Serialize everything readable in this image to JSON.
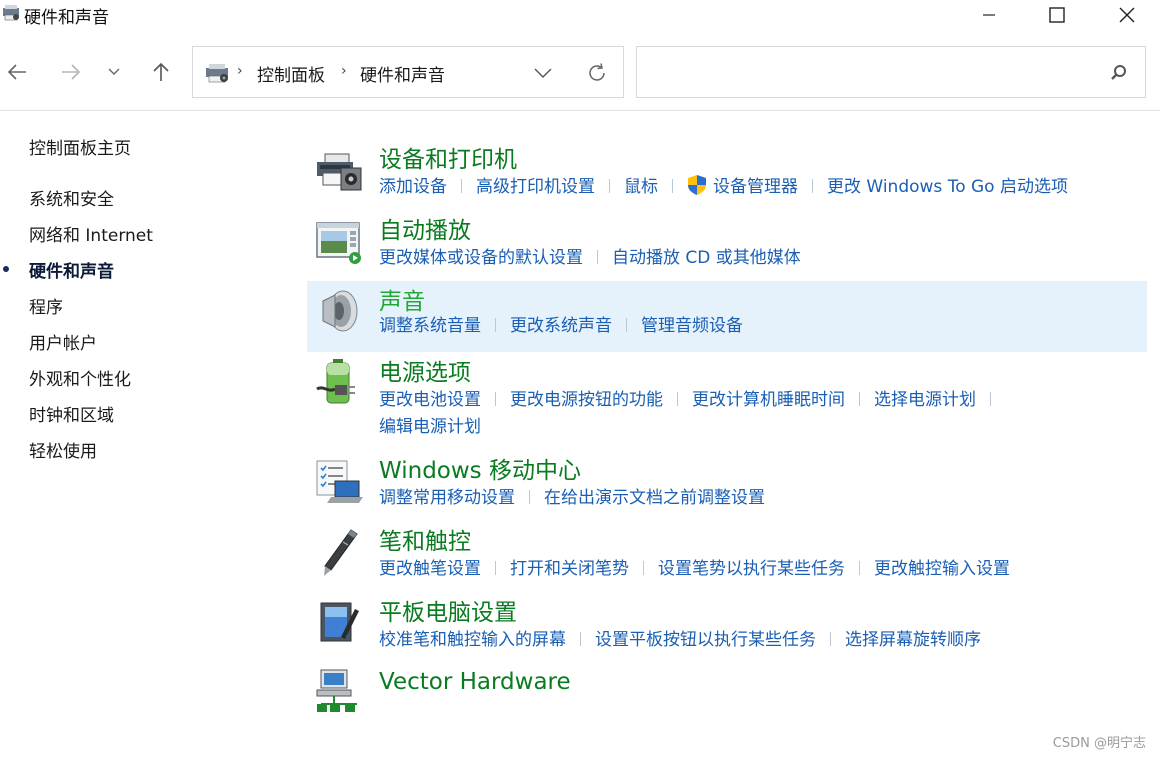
{
  "window": {
    "title": "硬件和声音",
    "minimize_icon": "minimize-icon",
    "maximize_icon": "maximize-icon",
    "close_icon": "close-icon"
  },
  "navigation": {
    "back_icon": "back-arrow-icon",
    "forward_icon": "forward-arrow-icon",
    "recent_icon": "chevron-down-icon",
    "up_icon": "up-arrow-icon",
    "breadcrumb": [
      "控制面板",
      "硬件和声音"
    ],
    "refresh_icon": "refresh-icon"
  },
  "search": {
    "value": "",
    "placeholder": ""
  },
  "sidebar": {
    "items": [
      {
        "label": "控制面板主页",
        "active": false
      },
      {
        "label": "系统和安全",
        "active": false
      },
      {
        "label": "网络和 Internet",
        "active": false
      },
      {
        "label": "硬件和声音",
        "active": true
      },
      {
        "label": "程序",
        "active": false
      },
      {
        "label": "用户帐户",
        "active": false
      },
      {
        "label": "外观和个性化",
        "active": false
      },
      {
        "label": "时钟和区域",
        "active": false
      },
      {
        "label": "轻松使用",
        "active": false
      }
    ]
  },
  "categories": [
    {
      "title": "设备和打印机",
      "icon": "printer-icon",
      "links": [
        "添加设备",
        "高级打印机设置",
        "鼠标",
        "设备管理器",
        "更改 Windows To Go 启动选项"
      ]
    },
    {
      "title": "自动播放",
      "icon": "autoplay-icon",
      "links": [
        "更改媒体或设备的默认设置",
        "自动播放 CD 或其他媒体"
      ]
    },
    {
      "title": "声音",
      "icon": "speaker-icon",
      "links": [
        "调整系统音量",
        "更改系统声音",
        "管理音频设备"
      ]
    },
    {
      "title": "电源选项",
      "icon": "battery-icon",
      "links": [
        "更改电池设置",
        "更改电源按钮的功能",
        "更改计算机睡眠时间",
        "选择电源计划",
        "编辑电源计划"
      ]
    },
    {
      "title": "Windows 移动中心",
      "icon": "mobility-center-icon",
      "links": [
        "调整常用移动设置",
        "在给出演示文档之前调整设置"
      ]
    },
    {
      "title": "笔和触控",
      "icon": "pen-icon",
      "links": [
        "更改触笔设置",
        "打开和关闭笔势",
        "设置笔势以执行某些任务",
        "更改触控输入设置"
      ]
    },
    {
      "title": "平板电脑设置",
      "icon": "tablet-icon",
      "links": [
        "校准笔和触控输入的屏幕",
        "设置平板按钮以执行某些任务",
        "选择屏幕旋转顺序"
      ]
    },
    {
      "title": "Vector Hardware",
      "icon": "network-hardware-icon",
      "links": []
    }
  ],
  "watermark": "CSDN @明宁志",
  "colors": {
    "title_green": "#0a7b20",
    "link_blue": "#1a5fb4",
    "highlight_bg": "#e5f1fb"
  }
}
